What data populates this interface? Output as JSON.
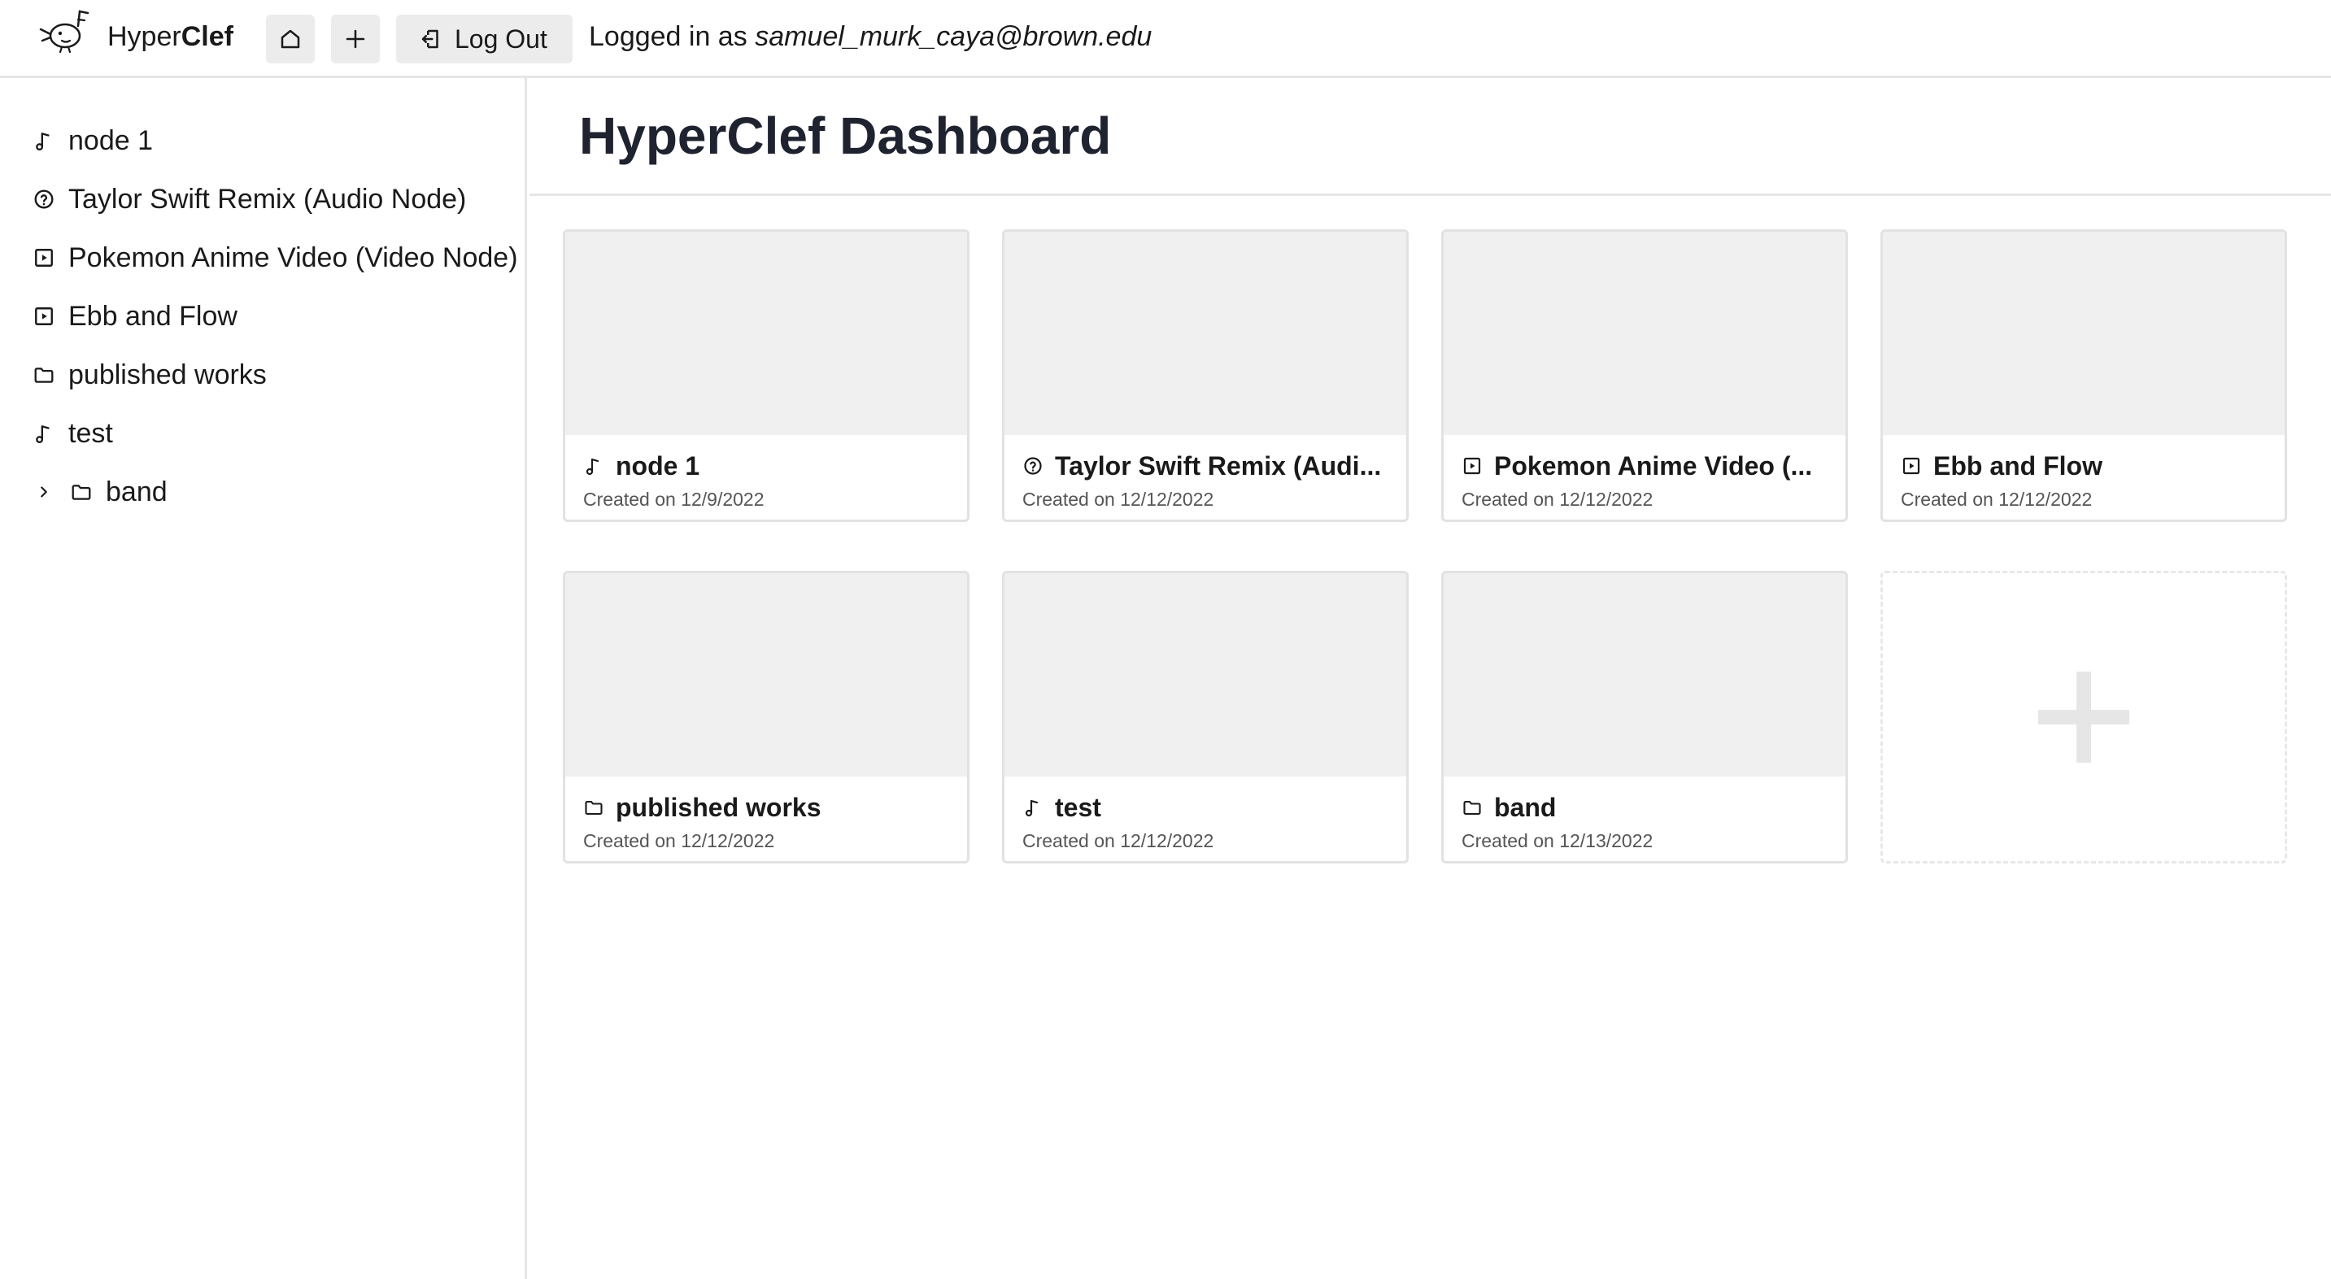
{
  "header": {
    "app_name_light": "Hyper",
    "app_name_bold": "Clef",
    "home_icon": "home-icon",
    "add_icon": "plus-icon",
    "logout_label": "Log Out",
    "logged_in_prefix": "Logged in as",
    "user_email": "samuel_murk_caya@brown.edu"
  },
  "sidebar": {
    "items": [
      {
        "label": "node 1",
        "icon": "music-note-icon"
      },
      {
        "label": "Taylor Swift Remix (Audio Node)",
        "icon": "question-circle-icon"
      },
      {
        "label": "Pokemon Anime Video (Video Node)",
        "icon": "video-play-icon"
      },
      {
        "label": "Ebb and Flow",
        "icon": "video-play-icon"
      },
      {
        "label": "published works",
        "icon": "folder-icon"
      },
      {
        "label": "test",
        "icon": "music-note-icon"
      },
      {
        "label": "band",
        "icon": "folder-icon",
        "expandable": true
      }
    ]
  },
  "main": {
    "title": "HyperClef Dashboard",
    "cards": [
      {
        "title": "node 1",
        "icon": "music-note-icon",
        "date": "Created on 12/9/2022"
      },
      {
        "title": "Taylor Swift Remix (Audi...",
        "icon": "question-circle-icon",
        "date": "Created on 12/12/2022"
      },
      {
        "title": "Pokemon Anime Video (...",
        "icon": "video-play-icon",
        "date": "Created on 12/12/2022"
      },
      {
        "title": "Ebb and Flow",
        "icon": "video-play-icon",
        "date": "Created on 12/12/2022"
      },
      {
        "title": "published works",
        "icon": "folder-icon",
        "date": "Created on 12/12/2022"
      },
      {
        "title": "test",
        "icon": "music-note-icon",
        "date": "Created on 12/12/2022"
      },
      {
        "title": "band",
        "icon": "folder-icon",
        "date": "Created on 12/13/2022"
      }
    ],
    "add_card_icon": "plus-icon"
  },
  "colors": {
    "thumb_bg": "#f0f0f0",
    "button_bg": "#ececec",
    "border": "#e2e2e2",
    "title_text": "#1f2330"
  }
}
